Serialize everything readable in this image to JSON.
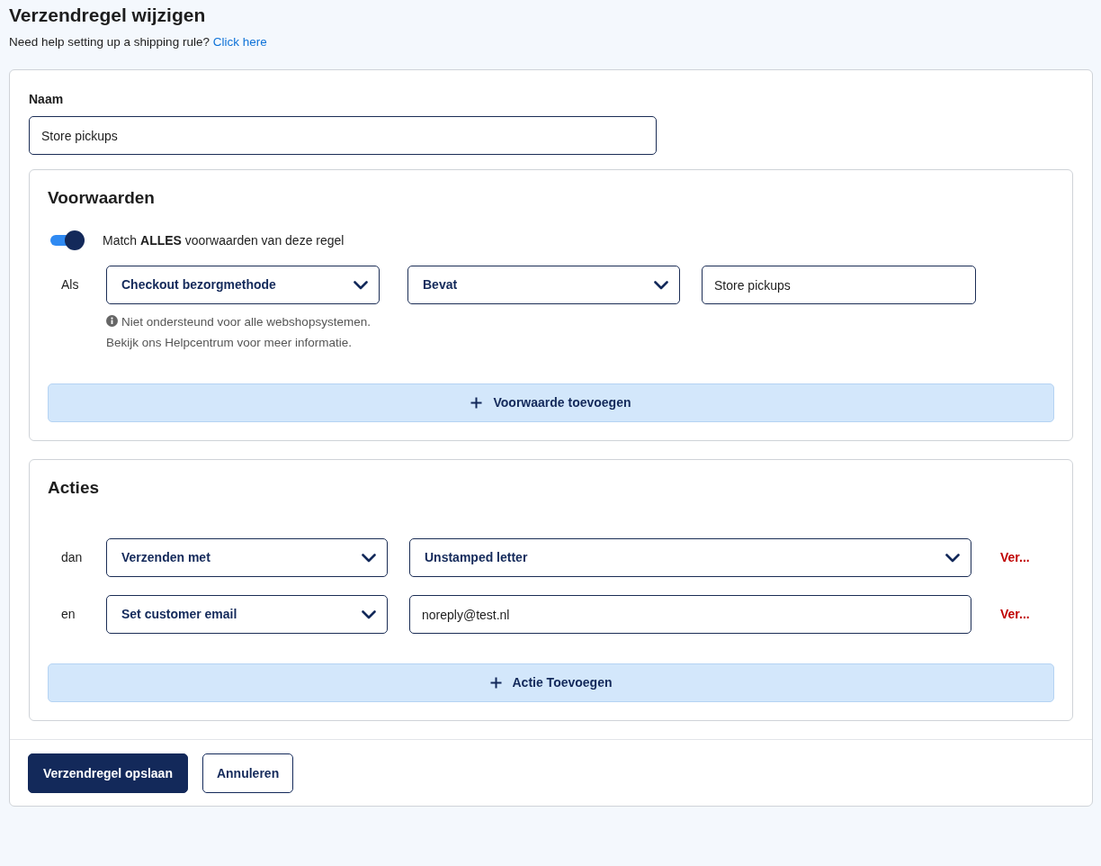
{
  "page": {
    "title": "Verzendregel wijzigen",
    "help_text": "Need help setting up a shipping rule?",
    "help_link": "Click here"
  },
  "form": {
    "name_label": "Naam",
    "name_value": "Store pickups",
    "conditions": {
      "title": "Voorwaarden",
      "match_toggle": {
        "on": true,
        "label": "Match **ALLES** voorwaarden van deze regel"
      },
      "rows": [
        {
          "connector": "Als",
          "field": "Checkout bezorgmethode",
          "note": "Niet ondersteund voor alle webshopsystemen. Bekijk ons Helpcentrum voor meer informatie.",
          "operator": "Bevat",
          "value": "Store pickups"
        }
      ],
      "add_button": "Voorwaarde toevoegen"
    },
    "actions": {
      "title": "Acties",
      "rows": [
        {
          "connector": "dan",
          "action": "Verzenden met",
          "argument": {
            "kind": "select",
            "text": "Unstamped letter"
          },
          "remove": "Ver..."
        },
        {
          "connector": "en",
          "action": "Set customer email",
          "argument": {
            "kind": "input",
            "text": "noreply@test.nl"
          },
          "remove": "Ver..."
        }
      ],
      "add_button": "Actie Toevoegen"
    },
    "buttons": [
      {
        "label": "Verzendregel opslaan",
        "kind": "primary"
      },
      {
        "label": "Annuleren",
        "kind": "secondary"
      }
    ]
  }
}
